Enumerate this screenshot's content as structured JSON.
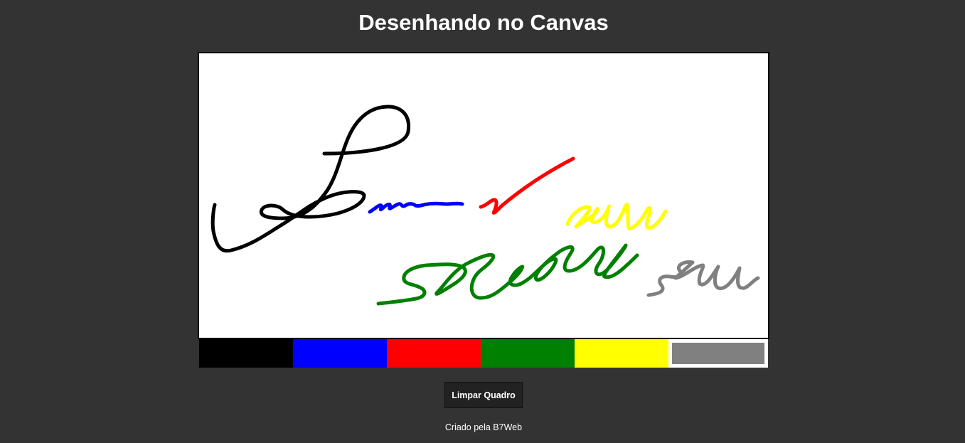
{
  "page": {
    "title": "Desenhando no Canvas",
    "credit": "Criado pela B7Web"
  },
  "canvas": {
    "background": "#ffffff",
    "border": "#000000"
  },
  "palette": {
    "colors": [
      {
        "name": "black",
        "hex": "#000000",
        "active": false
      },
      {
        "name": "blue",
        "hex": "#0000ff",
        "active": false
      },
      {
        "name": "red",
        "hex": "#ff0000",
        "active": false
      },
      {
        "name": "green",
        "hex": "#008000",
        "active": false
      },
      {
        "name": "yellow",
        "hex": "#ffff00",
        "active": false
      },
      {
        "name": "gray",
        "hex": "#808080",
        "active": true
      }
    ]
  },
  "toolbar": {
    "clear_label": "Limpar Quadro"
  }
}
